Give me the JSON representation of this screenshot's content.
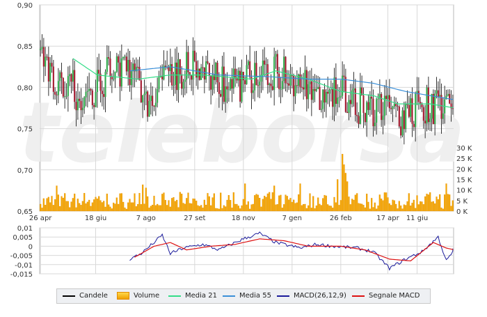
{
  "chart_data": {
    "type": "candlestick",
    "watermark": "teleborsa",
    "price_panel": {
      "ylim": [
        0.65,
        0.9
      ],
      "y_ticks": [
        "0,90",
        "0,85",
        "0,80",
        "0,75",
        "0,70",
        "0,65"
      ],
      "y_tick_values": [
        0.9,
        0.85,
        0.8,
        0.75,
        0.7,
        0.65
      ],
      "x_ticks": [
        "26 apr",
        "18 giu",
        "7 ago",
        "27 set",
        "18 nov",
        "7 gen",
        "26 feb",
        "17 apr",
        "11 giu"
      ],
      "x_tick_index": [
        0,
        34,
        65,
        95,
        125,
        155,
        185,
        214,
        232
      ],
      "n_sessions": 255,
      "price_anchors": [
        [
          0,
          0.845
        ],
        [
          12,
          0.8
        ],
        [
          25,
          0.795
        ],
        [
          40,
          0.81
        ],
        [
          52,
          0.83
        ],
        [
          60,
          0.8
        ],
        [
          65,
          0.78
        ],
        [
          72,
          0.815
        ],
        [
          90,
          0.825
        ],
        [
          110,
          0.805
        ],
        [
          125,
          0.8
        ],
        [
          140,
          0.82
        ],
        [
          155,
          0.81
        ],
        [
          170,
          0.79
        ],
        [
          185,
          0.8
        ],
        [
          195,
          0.78
        ],
        [
          208,
          0.77
        ],
        [
          222,
          0.765
        ],
        [
          235,
          0.775
        ],
        [
          255,
          0.78
        ]
      ],
      "ma21_anchors": [
        [
          20,
          0.835
        ],
        [
          35,
          0.815
        ],
        [
          60,
          0.81
        ],
        [
          80,
          0.815
        ],
        [
          100,
          0.815
        ],
        [
          130,
          0.81
        ],
        [
          145,
          0.82
        ],
        [
          165,
          0.81
        ],
        [
          185,
          0.795
        ],
        [
          205,
          0.79
        ],
        [
          220,
          0.78
        ],
        [
          240,
          0.78
        ],
        [
          255,
          0.775
        ]
      ],
      "ma55_anchors": [
        [
          55,
          0.82
        ],
        [
          80,
          0.825
        ],
        [
          110,
          0.815
        ],
        [
          140,
          0.813
        ],
        [
          165,
          0.81
        ],
        [
          185,
          0.81
        ],
        [
          205,
          0.805
        ],
        [
          225,
          0.795
        ],
        [
          255,
          0.785
        ]
      ]
    },
    "volume_axis": {
      "ylim": [
        0,
        35000
      ],
      "ticks": [
        "30 K",
        "25 K",
        "20 K",
        "15 K",
        "10 K",
        "5 K",
        "0 K"
      ],
      "tick_values": [
        30000,
        25000,
        20000,
        15000,
        10000,
        5000,
        0
      ],
      "spikes": [
        [
          186,
          27000
        ],
        [
          187,
          22000
        ],
        [
          188,
          18000
        ],
        [
          189,
          14000
        ],
        [
          10,
          12000
        ],
        [
          63,
          12500
        ],
        [
          65,
          11000
        ],
        [
          160,
          13000
        ],
        [
          183,
          15000
        ],
        [
          250,
          13000
        ],
        [
          126,
          13000
        ],
        [
          144,
          12000
        ]
      ]
    },
    "macd_panel": {
      "ylim": [
        -0.015,
        0.01
      ],
      "y_ticks": [
        "0,01",
        "0,005",
        "0",
        "-0,005",
        "-0,01",
        "-0,015"
      ],
      "y_tick_values": [
        0.01,
        0.005,
        0,
        -0.005,
        -0.01,
        -0.015
      ],
      "macd_anchors": [
        [
          55,
          -0.007
        ],
        [
          62,
          -0.004
        ],
        [
          70,
          0.002
        ],
        [
          75,
          0.006
        ],
        [
          80,
          -0.004
        ],
        [
          88,
          -0.001
        ],
        [
          100,
          0.001
        ],
        [
          110,
          -0.002
        ],
        [
          125,
          0.004
        ],
        [
          135,
          0.007
        ],
        [
          145,
          0.002
        ],
        [
          160,
          -0.001
        ],
        [
          170,
          0.001
        ],
        [
          180,
          0.0
        ],
        [
          195,
          -0.001
        ],
        [
          205,
          -0.003
        ],
        [
          215,
          -0.012
        ],
        [
          225,
          -0.007
        ],
        [
          235,
          -0.003
        ],
        [
          245,
          0.005
        ],
        [
          250,
          -0.008
        ],
        [
          255,
          -0.002
        ]
      ],
      "signal_anchors": [
        [
          58,
          -0.006
        ],
        [
          70,
          0.0
        ],
        [
          80,
          0.002
        ],
        [
          90,
          -0.002
        ],
        [
          105,
          0.0
        ],
        [
          120,
          0.001
        ],
        [
          135,
          0.004
        ],
        [
          150,
          0.003
        ],
        [
          165,
          0.0
        ],
        [
          185,
          0.0
        ],
        [
          200,
          -0.002
        ],
        [
          215,
          -0.007
        ],
        [
          228,
          -0.008
        ],
        [
          242,
          0.002
        ],
        [
          250,
          -0.001
        ],
        [
          255,
          -0.002
        ]
      ]
    },
    "legend": [
      {
        "label": "Candele",
        "kind": "line",
        "color": "#000000"
      },
      {
        "label": "Volume",
        "kind": "box",
        "color": "#f5a800"
      },
      {
        "label": "Media 21",
        "kind": "line",
        "color": "#33dd88"
      },
      {
        "label": "Media 55",
        "kind": "line",
        "color": "#3a8fd8"
      },
      {
        "label": "MACD(26,12,9)",
        "kind": "line",
        "color": "#1a1a9a"
      },
      {
        "label": "Segnale MACD",
        "kind": "line",
        "color": "#dd1111"
      }
    ],
    "colors": {
      "up": "#2eaa4a",
      "down": "#a3182e",
      "volume": "#f5a800",
      "ma21": "#33dd88",
      "ma55": "#3a8fd8",
      "macd": "#1a1a9a",
      "signal": "#dd1111",
      "grid": "#d8d8d8",
      "watermark": "#efefef"
    }
  }
}
